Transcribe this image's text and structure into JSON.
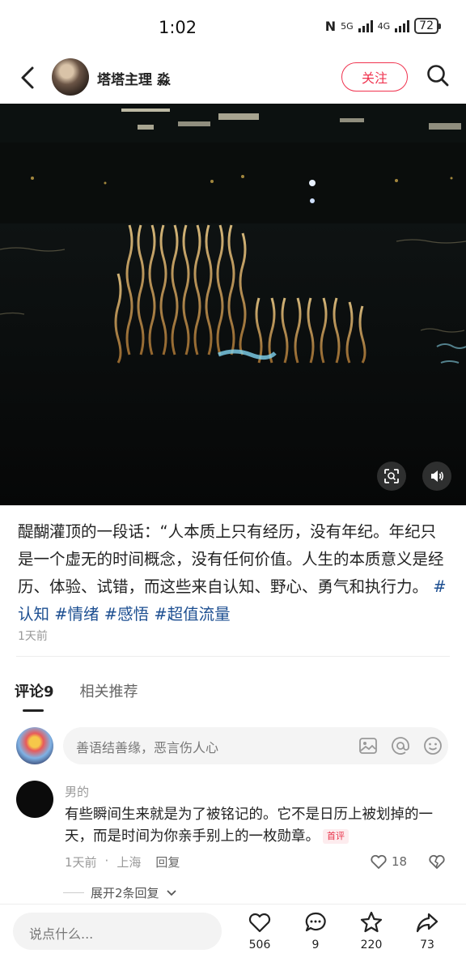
{
  "status_bar": {
    "time": "1:02",
    "battery": "72",
    "net1": "5G",
    "net2": "4G"
  },
  "header": {
    "author_name": "塔塔主理 淼",
    "follow_label": "关注"
  },
  "post": {
    "caption_text": "醍醐灌顶的一段话：“人本质上只有经历，没有年纪。年纪只是一个虚无的时间概念，没有任何价值。人生的本质意义是经历、体验、试错，而这些来自认知、野心、勇气和执行力。",
    "tags": [
      "#认知",
      "#情绪",
      "#感悟",
      "#超值流量"
    ],
    "time": "1天前"
  },
  "tabs": [
    {
      "label": "评论9",
      "active": true
    },
    {
      "label": "相关推荐",
      "active": false
    }
  ],
  "comment_input": {
    "placeholder": "善语结善缘，恶言伤人心"
  },
  "comments": [
    {
      "user": "男的",
      "text": "有些瞬间生来就是为了被铭记的。它不是日历上被划掉的一天，而是时间为你亲手别上的一枚勋章。",
      "badge": "首评",
      "time": "1天前",
      "location": "上海",
      "reply_label": "回复",
      "likes": "18",
      "expand_label": "展开2条回复"
    }
  ],
  "bottom_bar": {
    "input_placeholder": "说点什么...",
    "likes": "506",
    "comments": "9",
    "stars": "220",
    "shares": "73"
  },
  "colors": {
    "accent": "#f0334f",
    "tag": "#1d4f91"
  }
}
